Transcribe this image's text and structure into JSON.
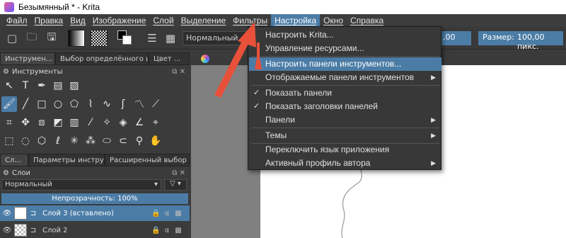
{
  "window": {
    "title": "Безымянный * - Krita"
  },
  "menubar": [
    "Файл",
    "Правка",
    "Вид",
    "Изображение",
    "Слой",
    "Выделение",
    "Фильтры",
    "Настройка",
    "Окно",
    "Справка"
  ],
  "toolbar": {
    "blend_mode": "Нормальный",
    "opacity_value": ",00",
    "size_label": "Размер:",
    "size_value": "100,00 пикс."
  },
  "dock": {
    "tabs_top": [
      "Инструмен...",
      "Выбор определённого цв...",
      "Цвет ..."
    ],
    "tools_header": "Инструменты",
    "tabs_bottom": [
      "Сл...",
      "Параметры инстру...",
      "Расширенный выбор ..."
    ],
    "layers_header": "Слои",
    "layers_mode": "Нормальный",
    "opacity_text": "Непрозрачность:  100%",
    "layers": [
      {
        "name": "Слой 3 (вставлено)",
        "selected": true
      },
      {
        "name": "Слой 2",
        "selected": false
      }
    ]
  },
  "menu": {
    "open": "Настройка",
    "items": [
      {
        "label": "Настроить Krita...",
        "check": false,
        "submenu": false
      },
      {
        "label": "Управление ресурсами...",
        "check": false,
        "submenu": false
      },
      {
        "label": "Настроить панели инструментов...",
        "check": false,
        "submenu": false,
        "highlight": true
      },
      {
        "label": "Отображаемые панели инструментов",
        "check": false,
        "submenu": true
      },
      {
        "label": "Показать панели",
        "check": true,
        "submenu": false
      },
      {
        "label": "Показать заголовки панелей",
        "check": true,
        "submenu": false
      },
      {
        "label": "Панели",
        "check": false,
        "submenu": true
      },
      {
        "label": "Темы",
        "check": false,
        "submenu": true
      },
      {
        "label": "Переключить язык приложения",
        "check": false,
        "submenu": false
      },
      {
        "label": "Активный профиль автора",
        "check": false,
        "submenu": true
      }
    ]
  },
  "colors": {
    "accent": "#4b7ca6",
    "arrow": "#e8503a"
  },
  "icons": {
    "check": "✓",
    "submenu": "▶"
  }
}
